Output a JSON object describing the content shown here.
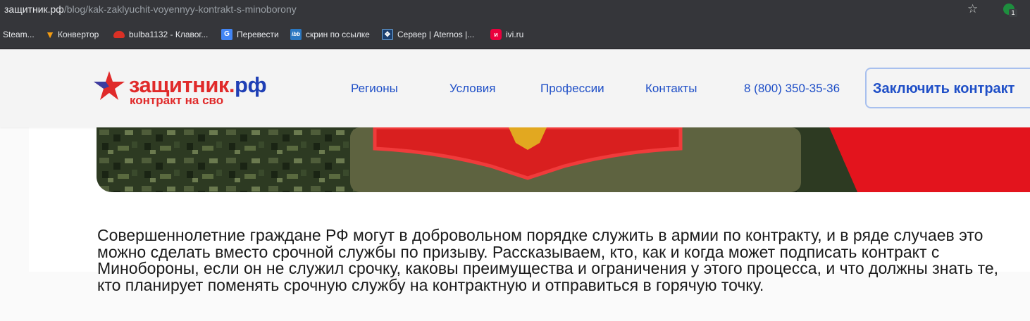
{
  "browser": {
    "url_host": "защитник.рф",
    "url_path": "/blog/kak-zaklyuchit-voyennyy-kontrakt-s-minoborony",
    "extension_badge": "1",
    "bookmarks": [
      {
        "label": "Steam...",
        "icon": "steam-icon"
      },
      {
        "label": "Конвертор",
        "icon": "converter-icon"
      },
      {
        "label": "bulba1132 - Клавог...",
        "icon": "car-icon"
      },
      {
        "label": "Перевести",
        "icon": "google-translate-icon"
      },
      {
        "label": "скрин по ссылке",
        "icon": "ibb-icon"
      },
      {
        "label": "Сервер | Aternos |...",
        "icon": "aternos-icon"
      },
      {
        "label": "ivi.ru",
        "icon": "ivi-icon"
      }
    ]
  },
  "site": {
    "logo_name": "защитник.",
    "logo_tld": "рф",
    "logo_subtitle": "контракт на сво",
    "nav": [
      "Регионы",
      "Условия",
      "Профессии",
      "Контакты"
    ],
    "phone": "8 (800) 350-35-36",
    "cta_label": "Заключить контракт"
  },
  "article": {
    "paragraph": "Совершеннолетние граждане РФ могут в добровольном порядке служить в армии по контракту, и в ряде случаев это можно сделать вместо срочной службы по призыву. Рассказываем, кто, как и когда может подписать контракт с Минобороны, если он не служил срочку, каковы преимущества и ограничения у этого процесса, и что должны знать те, кто планирует поменять срочную службу на контрактную и отправиться в горячую точку."
  },
  "colors": {
    "brand_red": "#e02a2a",
    "brand_blue": "#1f4fc7",
    "chrome_bg": "#35363a"
  }
}
